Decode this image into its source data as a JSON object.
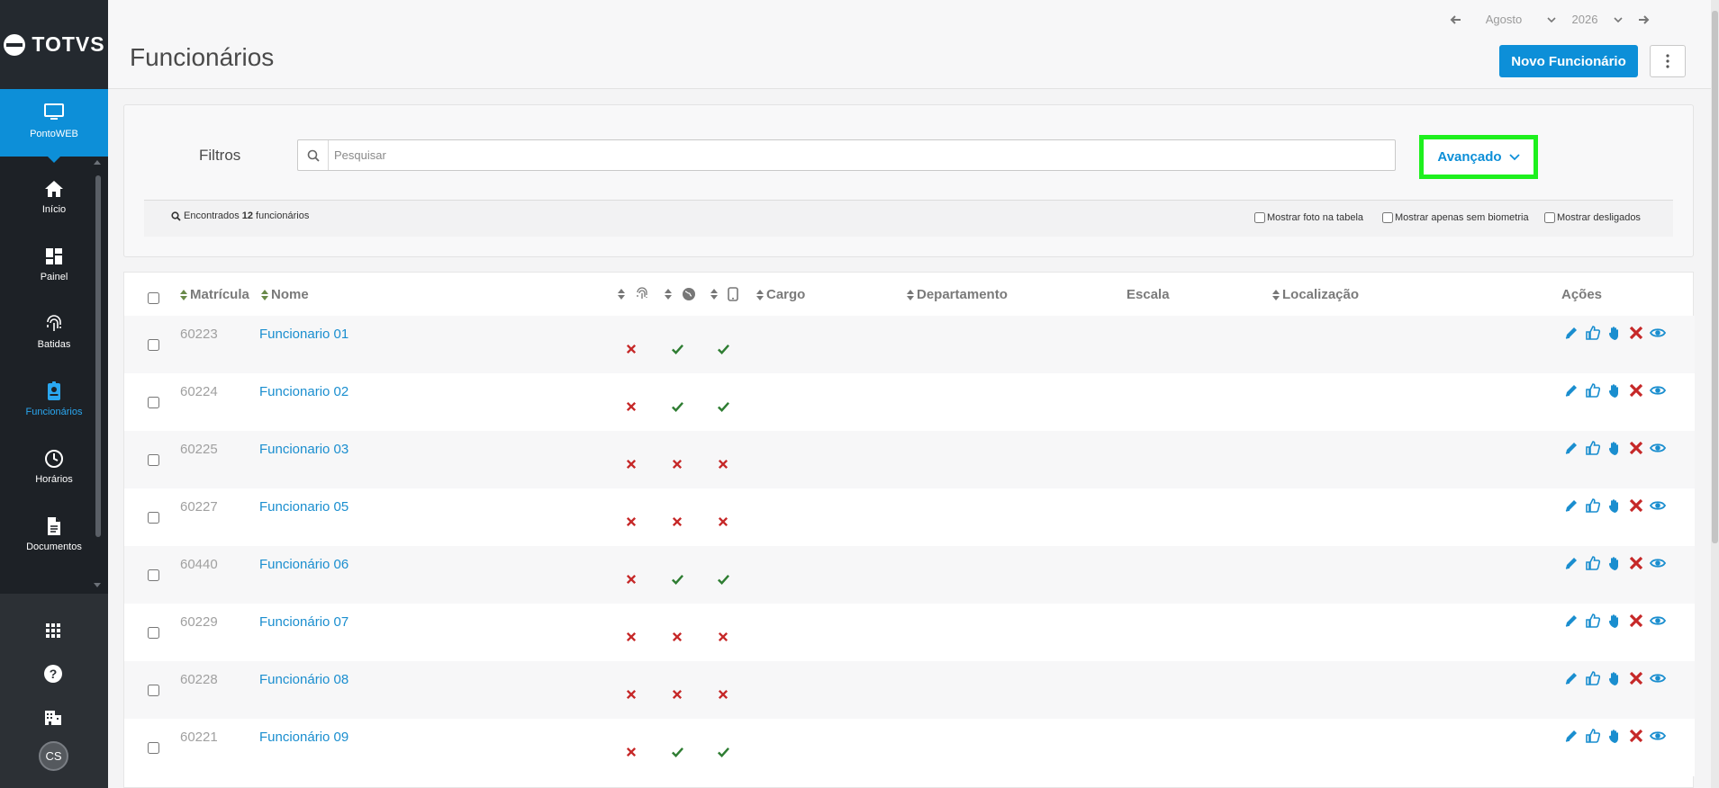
{
  "app": {
    "brand": "TOTVS",
    "product": "PontoWEB"
  },
  "sidebar": {
    "items": [
      {
        "label": "Início",
        "icon": "home-icon",
        "active": false
      },
      {
        "label": "Painel",
        "icon": "dashboard-icon",
        "active": false
      },
      {
        "label": "Batidas",
        "icon": "fingerprint-icon",
        "active": false
      },
      {
        "label": "Funcionários",
        "icon": "badge-icon",
        "active": true
      },
      {
        "label": "Horários",
        "icon": "clock-icon",
        "active": false
      },
      {
        "label": "Documentos",
        "icon": "document-icon",
        "active": false
      }
    ],
    "bottom_icons": [
      "apps-grid-icon",
      "help-icon",
      "building-icon"
    ],
    "avatar_initials": "CS"
  },
  "header": {
    "title": "Funcionários",
    "month": "Agosto",
    "year": "2026",
    "new_button_label": "Novo Funcionário"
  },
  "filters": {
    "label": "Filtros",
    "search_placeholder": "Pesquisar",
    "search_value": "",
    "advanced_label": "Avançado",
    "found_prefix": "Encontrados",
    "found_count": "12",
    "found_suffix": "funcionários",
    "options": [
      {
        "label": "Mostrar foto na tabela",
        "checked": false
      },
      {
        "label": "Mostrar apenas sem biometria",
        "checked": false
      },
      {
        "label": "Mostrar desligados",
        "checked": false
      }
    ]
  },
  "table": {
    "columns": {
      "matricula": "Matrícula",
      "nome": "Nome",
      "cargo": "Cargo",
      "departamento": "Departamento",
      "escala": "Escala",
      "localizacao": "Localização",
      "acoes": "Ações"
    },
    "status_icons": [
      "fingerprint-icon",
      "globe-icon",
      "mobile-icon"
    ],
    "action_icons": [
      "edit-icon",
      "approve-icon",
      "punch-icon",
      "delete-icon",
      "view-icon"
    ],
    "rows": [
      {
        "matricula": "60223",
        "nome": "Funcionario 01",
        "biometria": false,
        "web": true,
        "mobile": true
      },
      {
        "matricula": "60224",
        "nome": "Funcionario 02",
        "biometria": false,
        "web": true,
        "mobile": true
      },
      {
        "matricula": "60225",
        "nome": "Funcionario 03",
        "biometria": false,
        "web": false,
        "mobile": false
      },
      {
        "matricula": "60227",
        "nome": "Funcionario 05",
        "biometria": false,
        "web": false,
        "mobile": false
      },
      {
        "matricula": "60440",
        "nome": "Funcionário 06",
        "biometria": false,
        "web": true,
        "mobile": true
      },
      {
        "matricula": "60229",
        "nome": "Funcionário 07",
        "biometria": false,
        "web": false,
        "mobile": false
      },
      {
        "matricula": "60228",
        "nome": "Funcionário 08",
        "biometria": false,
        "web": false,
        "mobile": false
      },
      {
        "matricula": "60221",
        "nome": "Funcionário 09",
        "biometria": false,
        "web": true,
        "mobile": true
      }
    ]
  },
  "colors": {
    "accent": "#0d8fd8",
    "sidebar": "#1d2126",
    "check": "#2e7d32",
    "cross": "#c62828",
    "highlight": "#1ef01e"
  }
}
